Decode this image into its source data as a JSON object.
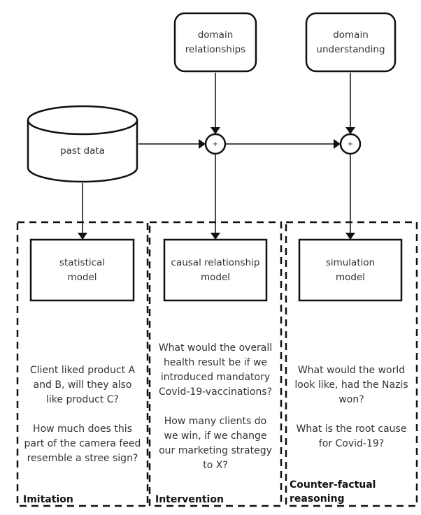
{
  "nodes": {
    "domain_relationships": "domain\nrelationships",
    "domain_understanding": "domain\nunderstanding",
    "past_data": "past data",
    "plus_1": "+",
    "plus_2": "+",
    "statistical_model": "statistical\nmodel",
    "causal_model": "causal relationship\nmodel",
    "simulation_model": "simulation\nmodel"
  },
  "columns": [
    {
      "category": "Imitation",
      "questions": [
        "Client liked product A\nand B, will they also\nlike product C?",
        "How much does this\npart of the camera feed\nresemble a stree sign?"
      ]
    },
    {
      "category": "Intervention",
      "questions": [
        "What would the overall\nhealth result be if we\nintroduced mandatory\nCovid-19-vaccinations?",
        "How many clients do\nwe win, if we change\nour marketing strategy\nto X?"
      ]
    },
    {
      "category": "Counter-factual\nreasoning",
      "questions": [
        "What would the world\nlook like, had the Nazis\nwon?",
        "What is the root cause\nfor Covid-19?"
      ]
    }
  ]
}
